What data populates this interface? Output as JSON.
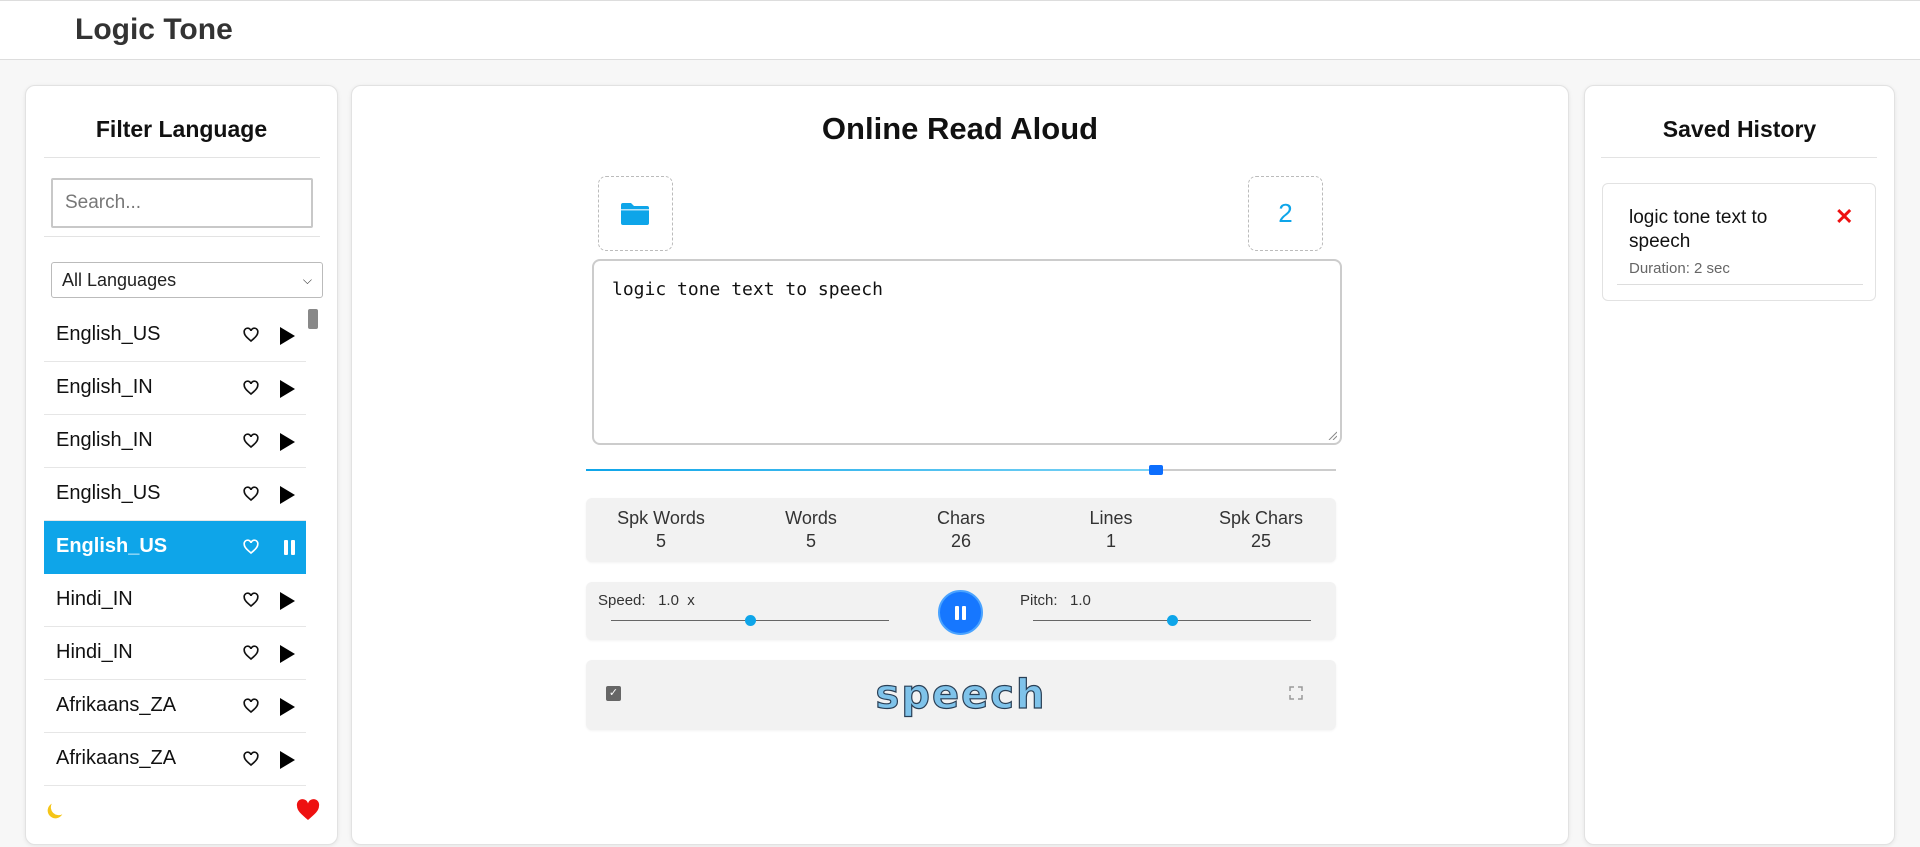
{
  "app": {
    "title": "Logic Tone"
  },
  "left": {
    "title": "Filter Language",
    "search_placeholder": "Search...",
    "language_select": "All Languages",
    "languages": [
      {
        "name": "English_US"
      },
      {
        "name": "English_IN"
      },
      {
        "name": "English_IN"
      },
      {
        "name": "English_US"
      },
      {
        "name": "English_US",
        "active": true
      },
      {
        "name": "Hindi_IN"
      },
      {
        "name": "Hindi_IN"
      },
      {
        "name": "Afrikaans_ZA"
      },
      {
        "name": "Afrikaans_ZA"
      }
    ]
  },
  "center": {
    "title": "Online Read Aloud",
    "count": "2",
    "text": "logic tone text to speech",
    "progress": 0.76,
    "stats": [
      {
        "label": "Spk Words",
        "value": "5"
      },
      {
        "label": "Words",
        "value": "5"
      },
      {
        "label": "Chars",
        "value": "26"
      },
      {
        "label": "Lines",
        "value": "1"
      },
      {
        "label": "Spk Chars",
        "value": "25"
      }
    ],
    "speed_label": "Speed:",
    "speed_value": "1.0",
    "speed_unit": "x",
    "speed_level": 0.5,
    "pitch_label": "Pitch:",
    "pitch_value": "1.0",
    "pitch_level": 0.5,
    "current_word": "speech",
    "highlight_checked": true
  },
  "right": {
    "title": "Saved History",
    "items": [
      {
        "text": "logic tone text to speech",
        "duration": "Duration: 2 sec"
      }
    ]
  },
  "colors": {
    "accent": "#0ea5e9",
    "play": "#1677ff",
    "danger": "#ee1111"
  }
}
